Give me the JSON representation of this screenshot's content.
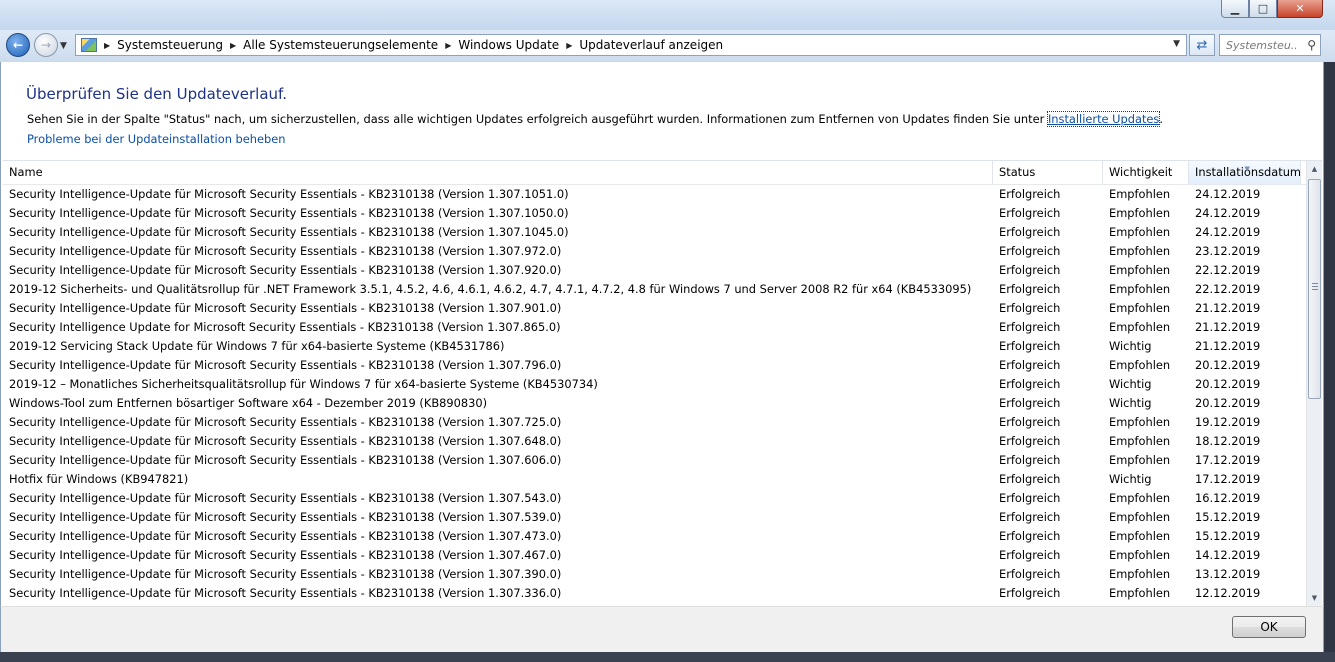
{
  "address": {
    "breadcrumbs": [
      "Systemsteuerung",
      "Alle Systemsteuerungselemente",
      "Windows Update",
      "Updateverlauf anzeigen"
    ]
  },
  "search": {
    "placeholder": "Systemsteu..."
  },
  "page": {
    "title": "Überprüfen Sie den Updateverlauf.",
    "description_text": "Sehen Sie in der Spalte \"Status\" nach, um sicherzustellen, dass alle wichtigen Updates erfolgreich ausgeführt wurden. Informationen zum Entfernen von Updates finden Sie unter ",
    "description_link": "Installierte Updates",
    "description_end": ".",
    "troubleshoot_link": "Probleme bei der Updateinstallation beheben"
  },
  "table": {
    "columns": [
      "Name",
      "Status",
      "Wichtigkeit",
      "Installationsdatum"
    ],
    "rows": [
      [
        "Security Intelligence-Update für Microsoft Security Essentials - KB2310138 (Version 1.307.1051.0)",
        "Erfolgreich",
        "Empfohlen",
        "24.12.2019"
      ],
      [
        "Security Intelligence-Update für Microsoft Security Essentials - KB2310138 (Version 1.307.1050.0)",
        "Erfolgreich",
        "Empfohlen",
        "24.12.2019"
      ],
      [
        "Security Intelligence-Update für Microsoft Security Essentials - KB2310138 (Version 1.307.1045.0)",
        "Erfolgreich",
        "Empfohlen",
        "24.12.2019"
      ],
      [
        "Security Intelligence-Update für Microsoft Security Essentials - KB2310138 (Version 1.307.972.0)",
        "Erfolgreich",
        "Empfohlen",
        "23.12.2019"
      ],
      [
        "Security Intelligence-Update für Microsoft Security Essentials - KB2310138 (Version 1.307.920.0)",
        "Erfolgreich",
        "Empfohlen",
        "22.12.2019"
      ],
      [
        "2019-12 Sicherheits- und Qualitätsrollup für .NET Framework 3.5.1, 4.5.2, 4.6, 4.6.1, 4.6.2, 4.7, 4.7.1, 4.7.2, 4.8 für Windows 7 und Server 2008 R2 für x64 (KB4533095)",
        "Erfolgreich",
        "Empfohlen",
        "22.12.2019"
      ],
      [
        "Security Intelligence-Update für Microsoft Security Essentials - KB2310138 (Version 1.307.901.0)",
        "Erfolgreich",
        "Empfohlen",
        "21.12.2019"
      ],
      [
        "Security Intelligence Update for Microsoft Security Essentials - KB2310138 (Version 1.307.865.0)",
        "Erfolgreich",
        "Empfohlen",
        "21.12.2019"
      ],
      [
        "2019-12 Servicing Stack Update für Windows 7 für x64-basierte Systeme (KB4531786)",
        "Erfolgreich",
        "Wichtig",
        "21.12.2019"
      ],
      [
        "Security Intelligence-Update für Microsoft Security Essentials - KB2310138 (Version 1.307.796.0)",
        "Erfolgreich",
        "Empfohlen",
        "20.12.2019"
      ],
      [
        "2019-12 – Monatliches Sicherheitsqualitätsrollup für Windows 7 für x64-basierte Systeme (KB4530734)",
        "Erfolgreich",
        "Wichtig",
        "20.12.2019"
      ],
      [
        "Windows-Tool zum Entfernen bösartiger Software x64 - Dezember 2019 (KB890830)",
        "Erfolgreich",
        "Wichtig",
        "20.12.2019"
      ],
      [
        "Security Intelligence-Update für Microsoft Security Essentials - KB2310138 (Version 1.307.725.0)",
        "Erfolgreich",
        "Empfohlen",
        "19.12.2019"
      ],
      [
        "Security Intelligence-Update für Microsoft Security Essentials - KB2310138 (Version 1.307.648.0)",
        "Erfolgreich",
        "Empfohlen",
        "18.12.2019"
      ],
      [
        "Security Intelligence-Update für Microsoft Security Essentials - KB2310138 (Version 1.307.606.0)",
        "Erfolgreich",
        "Empfohlen",
        "17.12.2019"
      ],
      [
        "Hotfix für Windows (KB947821)",
        "Erfolgreich",
        "Wichtig",
        "17.12.2019"
      ],
      [
        "Security Intelligence-Update für Microsoft Security Essentials - KB2310138 (Version 1.307.543.0)",
        "Erfolgreich",
        "Empfohlen",
        "16.12.2019"
      ],
      [
        "Security Intelligence-Update für Microsoft Security Essentials - KB2310138 (Version 1.307.539.0)",
        "Erfolgreich",
        "Empfohlen",
        "15.12.2019"
      ],
      [
        "Security Intelligence-Update für Microsoft Security Essentials - KB2310138 (Version 1.307.473.0)",
        "Erfolgreich",
        "Empfohlen",
        "15.12.2019"
      ],
      [
        "Security Intelligence-Update für Microsoft Security Essentials - KB2310138 (Version 1.307.467.0)",
        "Erfolgreich",
        "Empfohlen",
        "14.12.2019"
      ],
      [
        "Security Intelligence-Update für Microsoft Security Essentials - KB2310138 (Version 1.307.390.0)",
        "Erfolgreich",
        "Empfohlen",
        "13.12.2019"
      ],
      [
        "Security Intelligence-Update für Microsoft Security Essentials - KB2310138 (Version 1.307.336.0)",
        "Erfolgreich",
        "Empfohlen",
        "12.12.2019"
      ]
    ]
  },
  "footer": {
    "ok_label": "OK"
  },
  "icons": {
    "back": "back-arrow-icon",
    "forward": "forward-arrow-icon",
    "refresh": "refresh-icon",
    "search": "search-icon",
    "control_panel": "control-panel-icon"
  },
  "colors": {
    "title": "#1e3287",
    "link": "#0c4fa6"
  }
}
